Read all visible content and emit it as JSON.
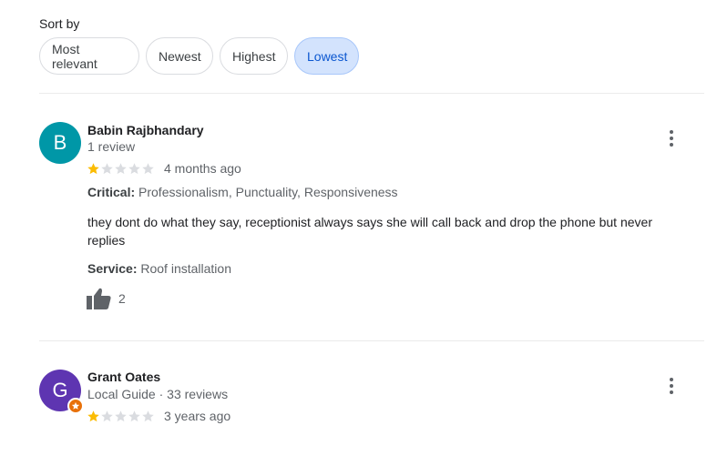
{
  "sort": {
    "label": "Sort by",
    "options": [
      "Most relevant",
      "Newest",
      "Highest",
      "Lowest"
    ],
    "selected": "Lowest"
  },
  "reviews": [
    {
      "avatar_initial": "B",
      "avatar_color": "#0097a7",
      "name": "Babin Rajbhandary",
      "subline": "1 review",
      "rating": 1,
      "rating_max": 5,
      "date": "4 months ago",
      "critical_label": "Critical:",
      "critical_value": "Professionalism, Punctuality, Responsiveness",
      "text": "they dont do what they say, receptionist always says she will call back and drop the phone but never replies",
      "service_label": "Service:",
      "service_value": "Roof installation",
      "likes": "2",
      "icons": {
        "like": "thumbs-up-icon",
        "more": "more-vert-icon"
      }
    },
    {
      "avatar_initial": "G",
      "avatar_color": "#5e35b1",
      "badge": "local-guide-star-icon",
      "badge_color": "#e8710a",
      "name": "Grant Oates",
      "subline": "Local Guide · 33 reviews",
      "rating": 1,
      "rating_max": 5,
      "date": "3 years ago",
      "icons": {
        "more": "more-vert-icon"
      }
    }
  ],
  "colors": {
    "star_filled": "#fbbc04",
    "star_empty": "#dadce0",
    "chip_selected_bg": "#d3e3fd"
  }
}
